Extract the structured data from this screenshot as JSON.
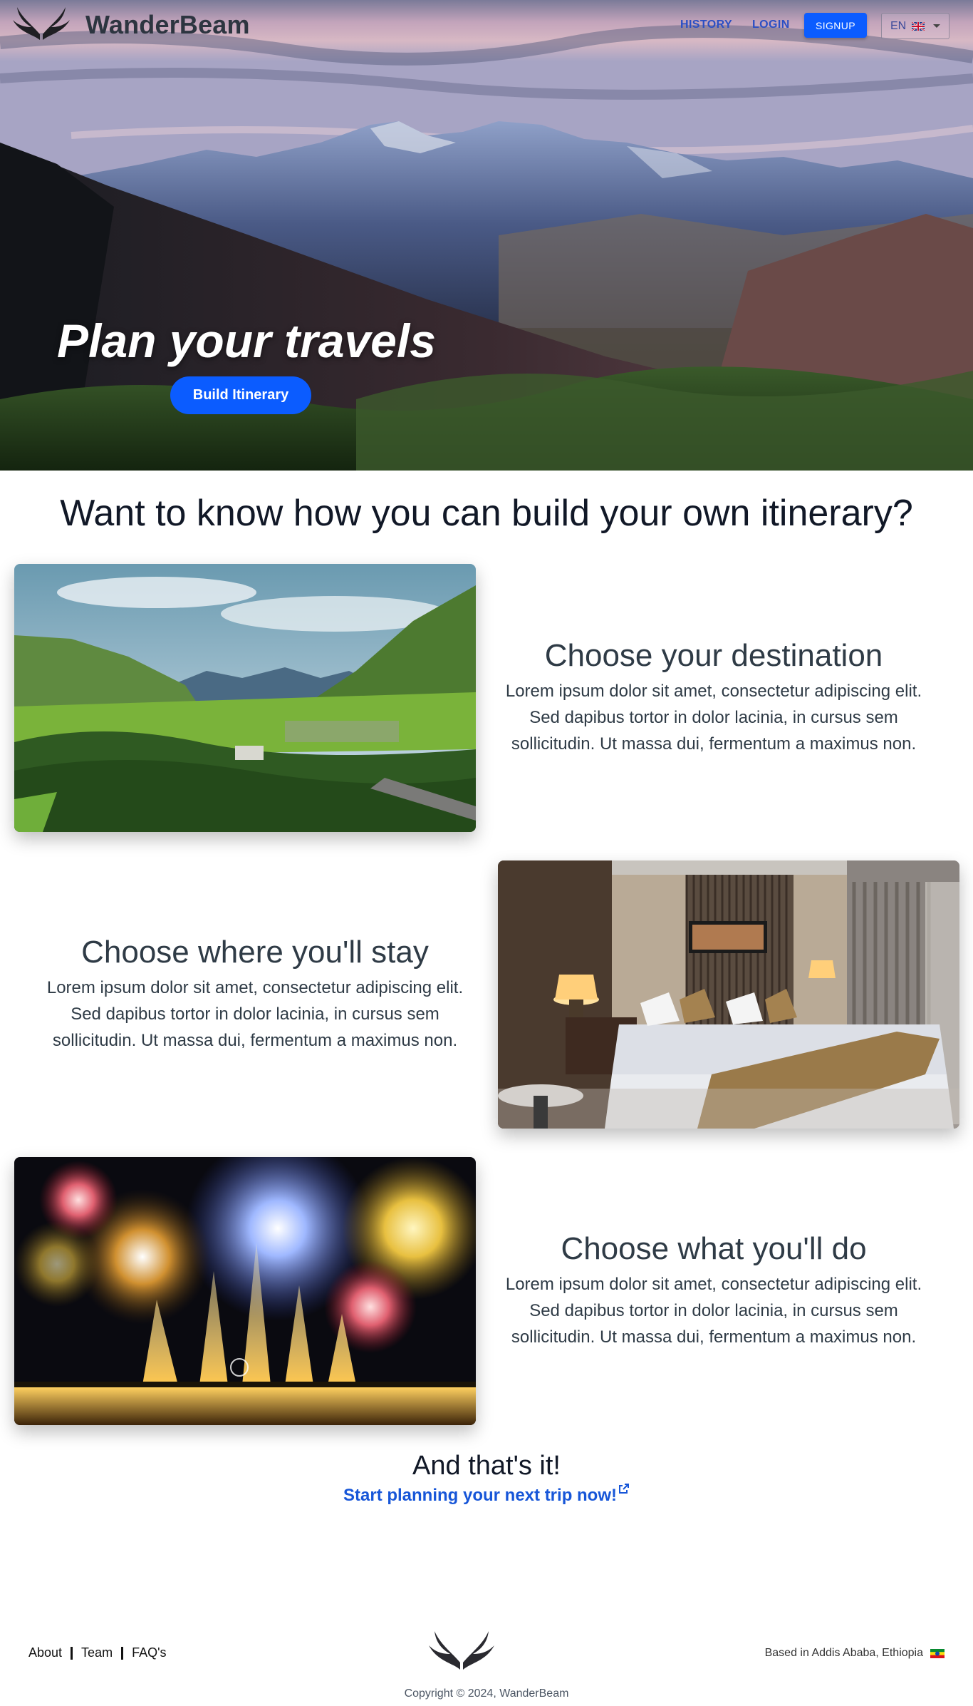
{
  "nav": {
    "brand": "WanderBeam",
    "history": "HISTORY",
    "login": "LOGIN",
    "signup": "SIGNUP",
    "language": "EN",
    "language_flag_icon": "uk-flag-icon",
    "logo_icon": "wings-logo-icon"
  },
  "hero": {
    "title": "Plan your travels",
    "button": "Build Itinerary"
  },
  "main": {
    "heading": "Want to know how you can build your own itinerary?",
    "features": [
      {
        "title": "Choose your destination",
        "text": "Lorem ipsum dolor sit amet, consectetur adipiscing elit. Sed dapibus tortor in dolor lacinia, in cursus sem sollicitudin. Ut massa dui, fermentum a maximus non."
      },
      {
        "title": "Choose where you'll stay",
        "text": "Lorem ipsum dolor sit amet, consectetur adipiscing elit. Sed dapibus tortor in dolor lacinia, in cursus sem sollicitudin. Ut massa dui, fermentum a maximus non."
      },
      {
        "title": "Choose what you'll do",
        "text": "Lorem ipsum dolor sit amet, consectetur adipiscing elit. Sed dapibus tortor in dolor lacinia, in cursus sem sollicitudin. Ut massa dui, fermentum a maximus non."
      }
    ],
    "outro_title": "And that's it!",
    "outro_link": "Start planning your next trip now!",
    "outro_link_icon": "external-link-icon"
  },
  "footer": {
    "links": [
      "About",
      "Team",
      "FAQ's"
    ],
    "location": "Based in Addis Ababa, Ethiopia",
    "location_flag_icon": "ethiopia-flag-icon",
    "copyright": "Copyright © 2024, WanderBeam"
  },
  "colors": {
    "primary": "#0b5cff",
    "link": "#1756d8",
    "heading": "#111827",
    "body_text": "#2f3b46"
  }
}
